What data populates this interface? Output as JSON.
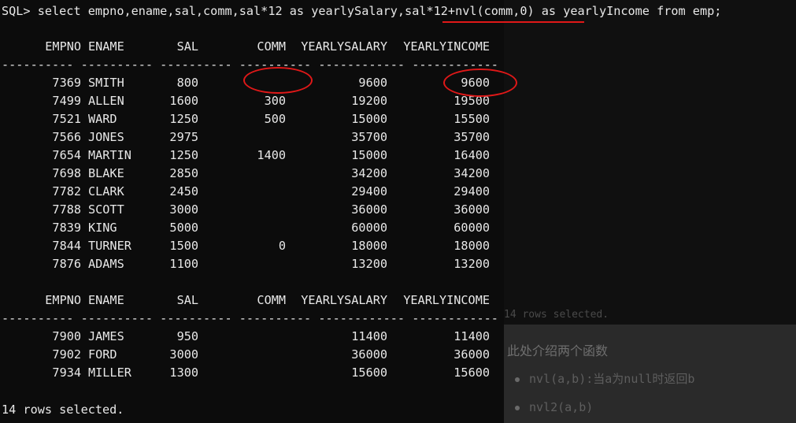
{
  "command": {
    "prompt": "SQL>",
    "sql": "select empno,ename,sal,comm,sal*12 as yearlySalary,sal*12+nvl(comm,0) as yearlyIncome from emp;"
  },
  "columns": [
    "EMPNO",
    "ENAME",
    "SAL",
    "COMM",
    "YEARLYSALARY",
    "YEARLYINCOME"
  ],
  "separator": "---------- ---------- ---------- ---------- ------------ ------------",
  "group1": [
    {
      "empno": "7369",
      "ename": "SMITH",
      "sal": "800",
      "comm": "",
      "ys": "9600",
      "yi": "9600"
    },
    {
      "empno": "7499",
      "ename": "ALLEN",
      "sal": "1600",
      "comm": "300",
      "ys": "19200",
      "yi": "19500"
    },
    {
      "empno": "7521",
      "ename": "WARD",
      "sal": "1250",
      "comm": "500",
      "ys": "15000",
      "yi": "15500"
    },
    {
      "empno": "7566",
      "ename": "JONES",
      "sal": "2975",
      "comm": "",
      "ys": "35700",
      "yi": "35700"
    },
    {
      "empno": "7654",
      "ename": "MARTIN",
      "sal": "1250",
      "comm": "1400",
      "ys": "15000",
      "yi": "16400"
    },
    {
      "empno": "7698",
      "ename": "BLAKE",
      "sal": "2850",
      "comm": "",
      "ys": "34200",
      "yi": "34200"
    },
    {
      "empno": "7782",
      "ename": "CLARK",
      "sal": "2450",
      "comm": "",
      "ys": "29400",
      "yi": "29400"
    },
    {
      "empno": "7788",
      "ename": "SCOTT",
      "sal": "3000",
      "comm": "",
      "ys": "36000",
      "yi": "36000"
    },
    {
      "empno": "7839",
      "ename": "KING",
      "sal": "5000",
      "comm": "",
      "ys": "60000",
      "yi": "60000"
    },
    {
      "empno": "7844",
      "ename": "TURNER",
      "sal": "1500",
      "comm": "0",
      "ys": "18000",
      "yi": "18000"
    },
    {
      "empno": "7876",
      "ename": "ADAMS",
      "sal": "1100",
      "comm": "",
      "ys": "13200",
      "yi": "13200"
    }
  ],
  "group2": [
    {
      "empno": "7900",
      "ename": "JAMES",
      "sal": "950",
      "comm": "",
      "ys": "11400",
      "yi": "11400"
    },
    {
      "empno": "7902",
      "ename": "FORD",
      "sal": "3000",
      "comm": "",
      "ys": "36000",
      "yi": "36000"
    },
    {
      "empno": "7934",
      "ename": "MILLER",
      "sal": "1300",
      "comm": "",
      "ys": "15600",
      "yi": "15600"
    }
  ],
  "footer": "14 rows selected.",
  "doc": {
    "heading": "此处介绍两个函数",
    "bullets": [
      "nvl(a,b):当a为null时返回b",
      "nvl2(a,b)"
    ]
  },
  "colors": {
    "annotation": "#e01818",
    "terminal_bg": "#0c0c0c",
    "text": "#e8e8e8"
  }
}
